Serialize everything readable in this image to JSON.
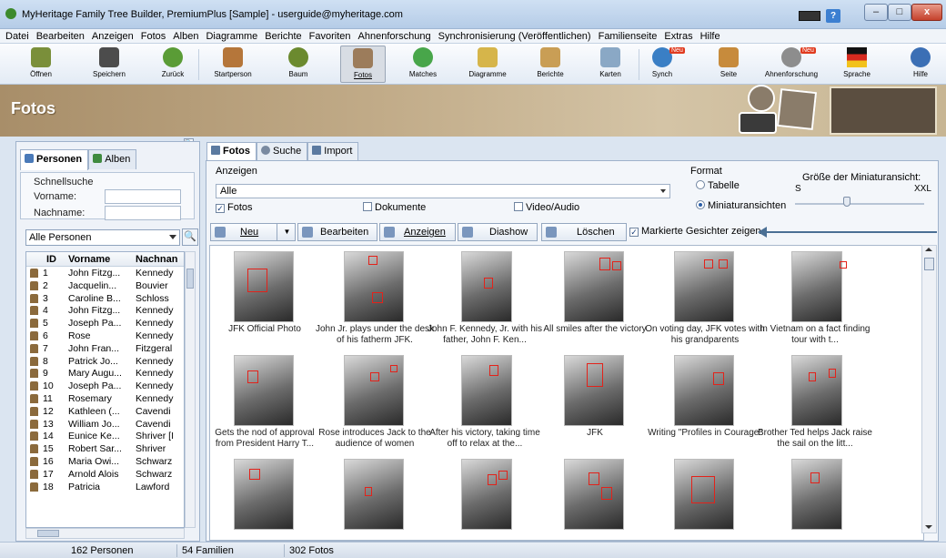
{
  "window": {
    "title": "MyHeritage Family Tree Builder, PremiumPlus [Sample] - userguide@myheritage.com",
    "help_glyph": "?",
    "minimize_glyph": "–",
    "maximize_glyph": "□",
    "close_glyph": "x"
  },
  "menu": [
    "Datei",
    "Bearbeiten",
    "Anzeigen",
    "Fotos",
    "Alben",
    "Diagramme",
    "Berichte",
    "Favoriten",
    "Ahnenforschung",
    "Synchronisierung (Veröffentlichen)",
    "Familienseite",
    "Extras",
    "Hilfe"
  ],
  "toolbar": {
    "items": [
      {
        "label": "Öffnen",
        "icon": "folder-icon",
        "color": "#7a8f3a"
      },
      {
        "label": "Speichern",
        "icon": "save-icon",
        "color": "#4c4c4c"
      },
      {
        "label": "Zurück",
        "icon": "back-arrow-icon",
        "color": "#5a9c36"
      },
      {
        "label": "Startperson",
        "icon": "home-icon",
        "color": "#b5763a"
      },
      {
        "label": "Baum",
        "icon": "tree-icon",
        "color": "#6b8a2f"
      },
      {
        "label": "Fotos",
        "icon": "photos-icon",
        "color": "#9c7c5b"
      },
      {
        "label": "Matches",
        "icon": "matches-icon",
        "color": "#48a64a"
      },
      {
        "label": "Diagramme",
        "icon": "chart-icon",
        "color": "#d6b54a"
      },
      {
        "label": "Berichte",
        "icon": "report-icon",
        "color": "#c99e55"
      },
      {
        "label": "Karten",
        "icon": "map-icon",
        "color": "#8aa8c5"
      },
      {
        "label": "Synch",
        "icon": "sync-icon",
        "color": "#3a7fc5",
        "badge": "Neu"
      },
      {
        "label": "Seite",
        "icon": "family-site-icon",
        "color": "#c78b3c"
      },
      {
        "label": "Ahnenforschung",
        "icon": "research-icon",
        "color": "#8d8d8d",
        "badge": "Neu"
      },
      {
        "label": "Sprache",
        "icon": "language-flag-icon",
        "color": "#d62a1f"
      },
      {
        "label": "Hilfe",
        "icon": "help-icon",
        "color": "#3b6fb5"
      }
    ]
  },
  "banner": {
    "heading": "Fotos"
  },
  "left": {
    "tabs": [
      "Personen",
      "Alben"
    ],
    "quicksearch": {
      "legend": "Schnellsuche",
      "firstname_label": "Vorname:",
      "lastname_label": "Nachname:",
      "firstname_value": "",
      "lastname_value": ""
    },
    "filter": "Alle Personen",
    "search_glyph": "🔍",
    "collapse_glyph": "«",
    "columns": [
      "ID",
      "Vorname",
      "Nachnan"
    ],
    "people": [
      {
        "id": "1",
        "first": "John Fitzg...",
        "last": "Kennedy"
      },
      {
        "id": "2",
        "first": "Jacquelin...",
        "last": "Bouvier"
      },
      {
        "id": "3",
        "first": "Caroline B...",
        "last": "Schloss"
      },
      {
        "id": "4",
        "first": "John Fitzg...",
        "last": "Kennedy"
      },
      {
        "id": "5",
        "first": "Joseph Pa...",
        "last": "Kennedy"
      },
      {
        "id": "6",
        "first": "Rose",
        "last": "Kennedy"
      },
      {
        "id": "7",
        "first": "John Fran...",
        "last": "Fitzgeral"
      },
      {
        "id": "8",
        "first": "Patrick Jo...",
        "last": "Kennedy"
      },
      {
        "id": "9",
        "first": "Mary Augu...",
        "last": "Kennedy"
      },
      {
        "id": "10",
        "first": "Joseph Pa...",
        "last": "Kennedy"
      },
      {
        "id": "11",
        "first": "Rosemary",
        "last": "Kennedy"
      },
      {
        "id": "12",
        "first": "Kathleen (...",
        "last": "Cavendi"
      },
      {
        "id": "13",
        "first": "William Jo...",
        "last": "Cavendi"
      },
      {
        "id": "14",
        "first": "Eunice Ke...",
        "last": "Shriver [I"
      },
      {
        "id": "15",
        "first": "Robert Sar...",
        "last": "Shriver"
      },
      {
        "id": "16",
        "first": "Maria Owi...",
        "last": "Schwarz"
      },
      {
        "id": "17",
        "first": "Arnold Alois",
        "last": "Schwarz"
      },
      {
        "id": "18",
        "first": "Patricia",
        "last": "Lawford"
      }
    ]
  },
  "main": {
    "tabs": [
      "Fotos",
      "Suche",
      "Import"
    ],
    "show": {
      "legend": "Anzeigen",
      "value": "Alle",
      "checkboxes": [
        {
          "label": "Fotos",
          "checked": true
        },
        {
          "label": "Dokumente",
          "checked": false
        },
        {
          "label": "Video/Audio",
          "checked": false
        }
      ]
    },
    "format": {
      "legend": "Format",
      "options": [
        {
          "label": "Tabelle",
          "selected": false
        },
        {
          "label": "Miniaturansichten",
          "selected": true
        }
      ],
      "size_label": "Größe der Miniaturansicht:",
      "size_min": "S",
      "size_max": "XXL",
      "size_level": 0.4
    },
    "actions": {
      "new": "Neu",
      "edit": "Bearbeiten",
      "view": "Anzeigen",
      "slideshow": "Diashow",
      "delete": "Löschen"
    },
    "show_faces": {
      "label": "Markierte Gesichter zeigen",
      "checked": true
    },
    "photos": [
      {
        "caption": "JFK Official Photo"
      },
      {
        "caption": "John Jr. plays under the desk of his fatherm JFK."
      },
      {
        "caption": "John F. Kennedy, Jr. with his father, John F. Ken..."
      },
      {
        "caption": "All smiles after the victory"
      },
      {
        "caption": "On voting day, JFK votes with his grandparents"
      },
      {
        "caption": "In Vietnam on a fact finding tour with t..."
      },
      {
        "caption": "Gets the nod of approval from President Harry T..."
      },
      {
        "caption": "Rose introduces Jack to the audience of women"
      },
      {
        "caption": "After his victory, taking time off to relax at the..."
      },
      {
        "caption": "JFK"
      },
      {
        "caption": "Writing \"Profiles in Courage\""
      },
      {
        "caption": "Brother Ted helps Jack raise the sail on the litt..."
      },
      {
        "caption": ""
      },
      {
        "caption": ""
      },
      {
        "caption": ""
      },
      {
        "caption": ""
      },
      {
        "caption": ""
      },
      {
        "caption": ""
      }
    ]
  },
  "status": {
    "people": "162 Personen",
    "families": "54 Familien",
    "photos": "302 Fotos"
  },
  "colors": {
    "face_box": "#e3221a",
    "accent": "#2c5fa8"
  }
}
